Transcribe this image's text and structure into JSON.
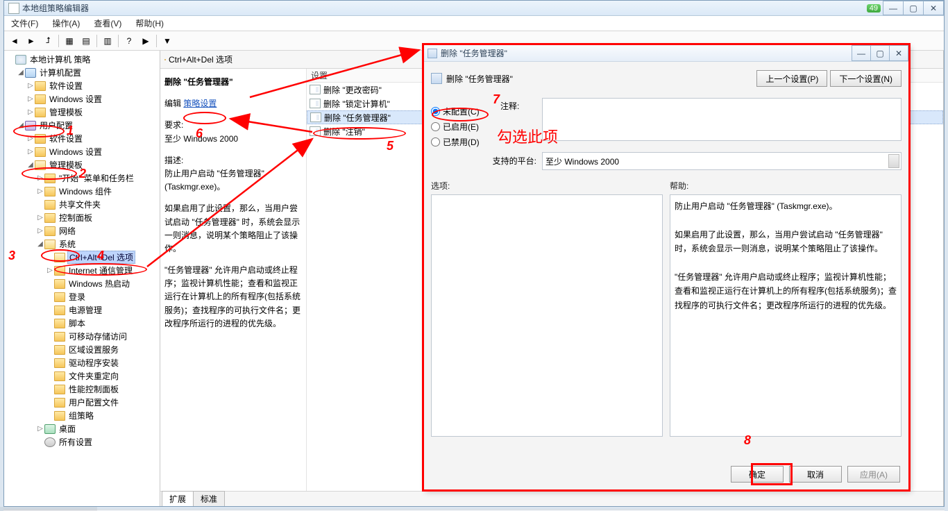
{
  "window": {
    "title": "本地组策略编辑器",
    "badge": "49"
  },
  "menubar": [
    "文件(F)",
    "操作(A)",
    "查看(V)",
    "帮助(H)"
  ],
  "tree": {
    "root": "本地计算机 策略",
    "computer_cfg": "计算机配置",
    "comp_children": [
      "软件设置",
      "Windows 设置",
      "管理模板"
    ],
    "user_cfg": "用户配置",
    "user_soft": "软件设置",
    "user_win": "Windows 设置",
    "user_tmpl": "管理模板",
    "tmpl_children_a": [
      "\"开始\" 菜单和任务栏",
      "Windows 组件",
      "共享文件夹",
      "控制面板",
      "网络"
    ],
    "system": "系统",
    "cad": "Ctrl+Alt+Del 选项",
    "sys_children_b": [
      "Internet 通信管理",
      "Windows 热启动",
      "登录",
      "电源管理",
      "脚本",
      "可移动存储访问",
      "区域设置服务",
      "驱动程序安装",
      "文件夹重定向",
      "性能控制面板",
      "用户配置文件",
      "组策略"
    ],
    "desktop": "桌面",
    "all_settings": "所有设置"
  },
  "middle": {
    "header": "Ctrl+Alt+Del 选项",
    "setting_title": "删除 \"任务管理器\"",
    "edit_prefix": "编辑",
    "edit_link": "策略设置",
    "req_label": "要求:",
    "req_value": "至少 Windows 2000",
    "desc_label": "描述:",
    "desc1": "防止用户启动 \"任务管理器\" (Taskmgr.exe)。",
    "desc2": "如果启用了此设置，那么，当用户尝试启动 \"任务管理器\" 时，系统会显示一则消息，说明某个策略阻止了该操作。",
    "desc3": "\"任务管理器\" 允许用户启动或终止程序；监视计算机性能；查看和监视正运行在计算机上的所有程序(包括系统服务)；查找程序的可执行文件名；更改程序所运行的进程的优先级。",
    "col_setting": "设置",
    "items": [
      "删除 \"更改密码\"",
      "删除 \"锁定计算机\"",
      "删除 \"任务管理器\"",
      "删除 \"注销\""
    ],
    "selected_index": 2,
    "tab_ext": "扩展",
    "tab_std": "标准"
  },
  "dialog": {
    "title": "删除 \"任务管理器\"",
    "header": "删除 \"任务管理器\"",
    "prev": "上一个设置(P)",
    "next": "下一个设置(N)",
    "r_notconf": "未配置(C)",
    "r_enabled": "已启用(E)",
    "r_disabled": "已禁用(D)",
    "comment_label": "注释:",
    "platform_label": "支持的平台:",
    "platform_value": "至少 Windows 2000",
    "opt_label": "选项:",
    "help_label": "帮助:",
    "help_p1": "防止用户启动 \"任务管理器\" (Taskmgr.exe)。",
    "help_p2": "如果启用了此设置，那么，当用户尝试启动 \"任务管理器\" 时，系统会显示一则消息，说明某个策略阻止了该操作。",
    "help_p3": "\"任务管理器\" 允许用户启动或终止程序；监视计算机性能；查看和监视正运行在计算机上的所有程序(包括系统服务)；查找程序的可执行文件名；更改程序所运行的进程的优先级。",
    "ok": "确定",
    "cancel": "取消",
    "apply": "应用(A)"
  },
  "annotations": {
    "markers": {
      "n1": "1",
      "n2": "2",
      "n3": "3",
      "n4": "4",
      "n5": "5",
      "n6": "6",
      "n7": "7",
      "n8": "8"
    },
    "check_text": "勾选此项"
  }
}
